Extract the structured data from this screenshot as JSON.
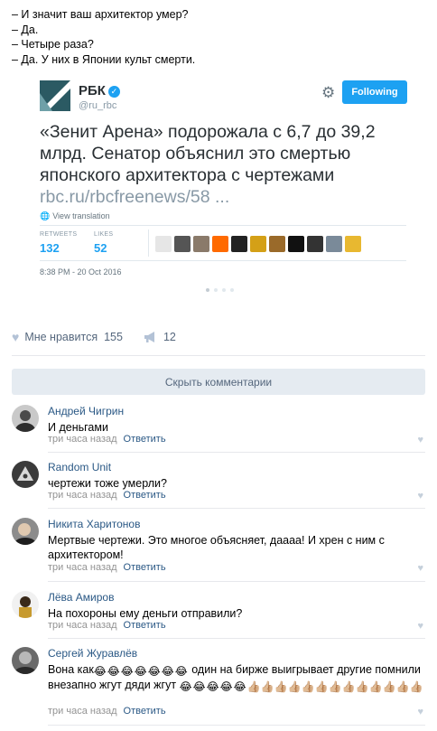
{
  "post": {
    "lines": [
      "– И значит ваш архитектор умер?",
      "– Да.",
      "– Четыре раза?",
      "– Да. У них в Японии культ смерти."
    ]
  },
  "tweet": {
    "name": "РБК",
    "handle": "@ru_rbc",
    "follow_label": "Following",
    "body": "«Зенит Арена» подорожала с 6,7 до 39,2 млрд. Сенатор объяснил это смертью японского архитектора с чертежами",
    "link": "rbc.ru/rbcfreenews/58 ...",
    "view_translation": "View translation",
    "retweets_label": "RETWEETS",
    "retweets_value": "132",
    "likes_label": "LIKES",
    "likes_value": "52",
    "date": "8:38 PM - 20 Oct 2016",
    "colors": {
      "accent": "#1da1f2",
      "logo": "#2b5a63"
    },
    "liker_avatar_colors": [
      "#e6e6e6",
      "#555555",
      "#8a7a6a",
      "#ff6a00",
      "#222222",
      "#d4a017",
      "#9a6a2a",
      "#111111",
      "#333333",
      "#7a8a99",
      "#e8b830"
    ]
  },
  "actions": {
    "like_label": "Мне нравится",
    "like_count": "155",
    "share_count": "12"
  },
  "hide_comments_label": "Скрыть комментарии",
  "comments": [
    {
      "author": "Андрей Чигрин",
      "text": "И деньгами",
      "time": "три часа назад",
      "reply": "Ответить"
    },
    {
      "author": "Random Unit",
      "text": "чертежи тоже умерли?",
      "time": "три часа назад",
      "reply": "Ответить"
    },
    {
      "author": "Никита Харитонов",
      "text": "Мертвые чертежи. Это многое объясняет, даааа! И хрен с ним с архитектором!",
      "time": "три часа назад",
      "reply": "Ответить"
    },
    {
      "author": "Лёва Амиров",
      "text": "На похороны ему деньги отправили?",
      "time": "три часа назад",
      "reply": "Ответить"
    },
    {
      "author": "Сергей Журавлёв",
      "text_a": "Вона как",
      "text_b": " один на бирже выигрывает другие помнили внезапно жгут дяди жгут ",
      "time": "три часа назад",
      "reply": "Ответить"
    }
  ],
  "emoji": {
    "laugh": "😂",
    "thumbs": "👍🏼"
  }
}
